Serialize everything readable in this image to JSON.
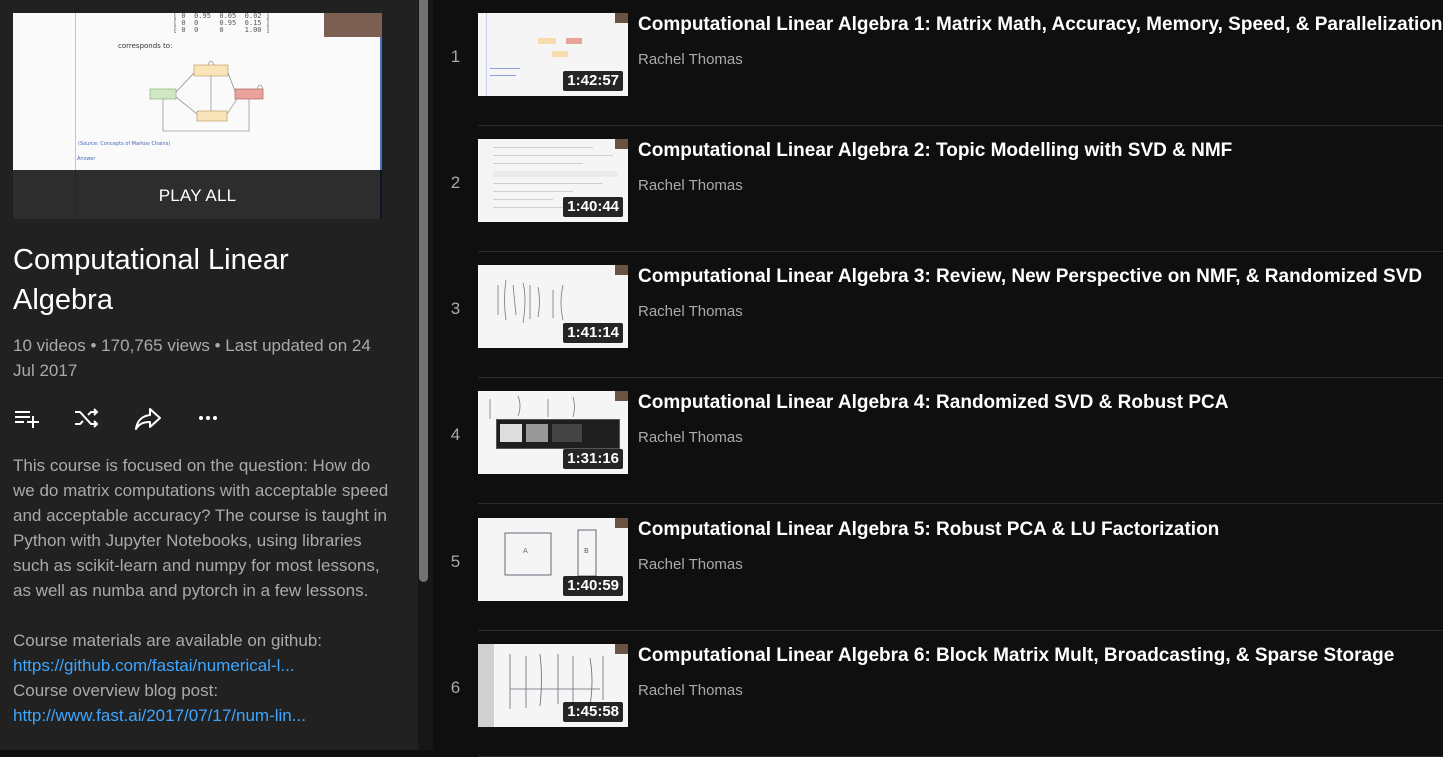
{
  "playlist": {
    "play_all_label": "PLAY ALL",
    "title": "Computational Linear Algebra",
    "meta": "10 videos • 170,765 views • Last updated on 24 Jul 2017",
    "description": {
      "text": "This course is focused on the question: How do we do matrix computations with acceptable speed and acceptable accuracy? The course is taught in Python with Jupyter Notebooks, using libraries such as scikit-learn and numpy for most lessons, as well as numba and pytorch in a few lessons.",
      "github_label": "Course materials are available on github:",
      "github_link": "https://github.com/fastai/numerical-l...",
      "blog_label": "Course overview blog post:",
      "blog_link": "http://www.fast.ai/2017/07/17/num-lin..."
    },
    "thumbnail": {
      "matrix_text": "[ 0  0.95  0.05  0.02 ]\n[ 0  0     0.95  0.15 ]\n[ 0  0     0     1.00 ]",
      "caption": "corresponds to:",
      "source_text": "(Source: Concepts of Markov Chains)",
      "answer_text": "Answer"
    },
    "actions": [
      {
        "name": "save-to-playlist-icon"
      },
      {
        "name": "shuffle-icon"
      },
      {
        "name": "share-icon"
      },
      {
        "name": "more-icon"
      }
    ]
  },
  "videos": [
    {
      "index": "1",
      "title": "Computational Linear Algebra 1: Matrix Math, Accuracy, Memory, Speed, & Parallelization",
      "channel": "Rachel Thomas",
      "duration": "1:42:57"
    },
    {
      "index": "2",
      "title": "Computational Linear Algebra 2: Topic Modelling with SVD & NMF",
      "channel": "Rachel Thomas",
      "duration": "1:40:44"
    },
    {
      "index": "3",
      "title": "Computational Linear Algebra 3: Review, New Perspective on NMF, & Randomized SVD",
      "channel": "Rachel Thomas",
      "duration": "1:41:14"
    },
    {
      "index": "4",
      "title": "Computational Linear Algebra 4: Randomized SVD & Robust PCA",
      "channel": "Rachel Thomas",
      "duration": "1:31:16"
    },
    {
      "index": "5",
      "title": "Computational Linear Algebra 5: Robust PCA & LU Factorization",
      "channel": "Rachel Thomas",
      "duration": "1:40:59"
    },
    {
      "index": "6",
      "title": "Computational Linear Algebra 6: Block Matrix Mult, Broadcasting, & Sparse Storage",
      "channel": "Rachel Thomas",
      "duration": "1:45:58"
    }
  ],
  "colors": {
    "background": "#0f0f0f",
    "sidebar": "#212121",
    "link": "#3ea6ff",
    "secondary_text": "#aaaaaa"
  }
}
